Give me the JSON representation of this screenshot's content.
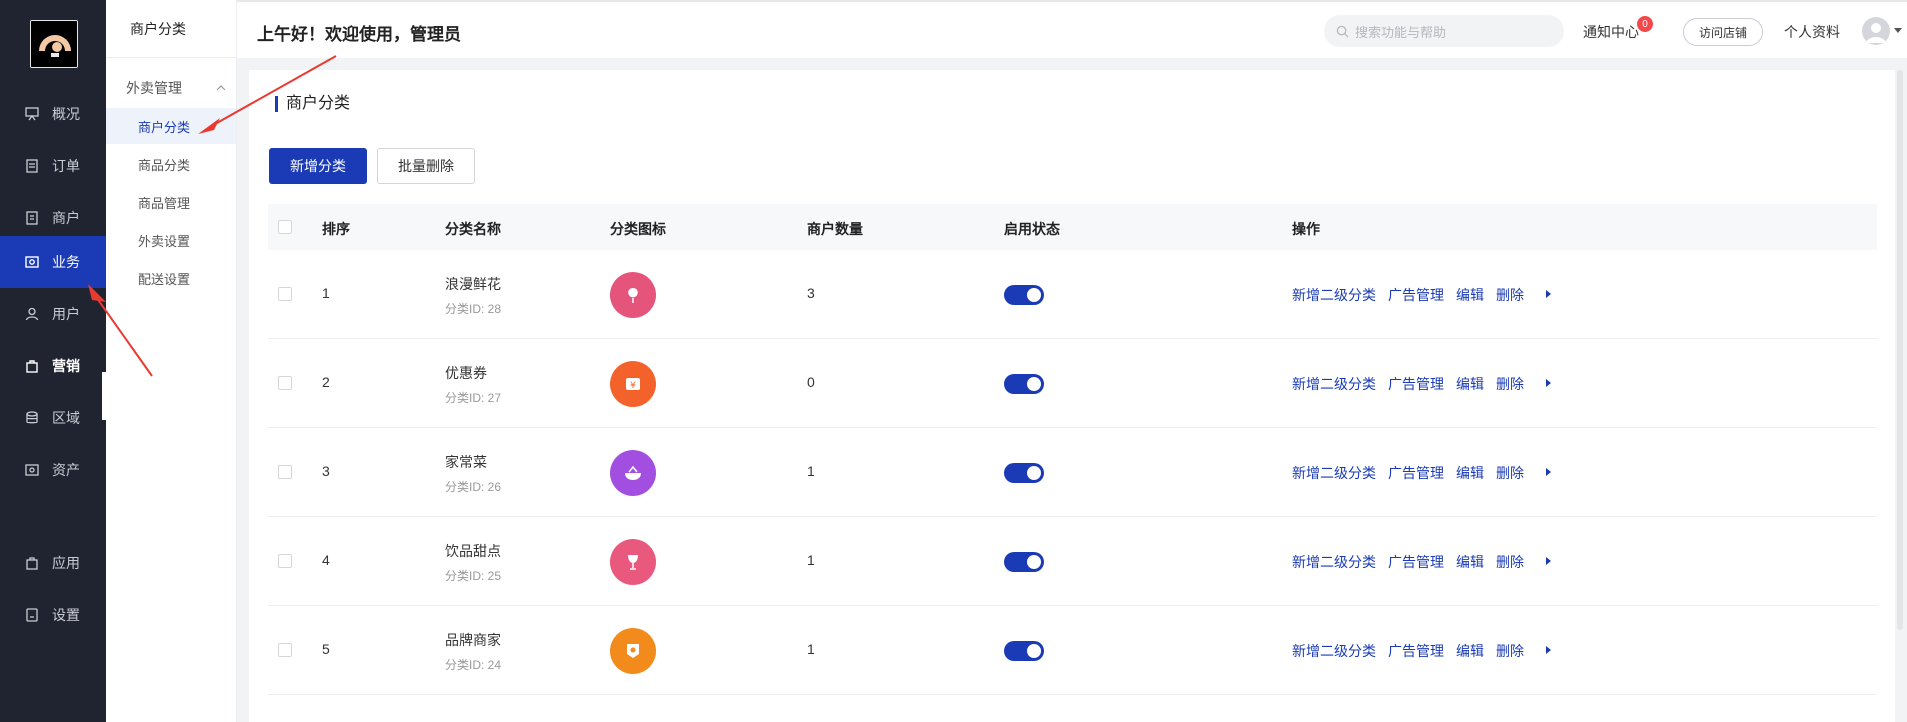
{
  "nav": {
    "items": [
      {
        "label": "概况",
        "icon": "presentation-board-icon"
      },
      {
        "label": "订单",
        "icon": "document-icon"
      },
      {
        "label": "商户",
        "icon": "store-icon"
      },
      {
        "label": "业务",
        "icon": "business-icon"
      },
      {
        "label": "用户",
        "icon": "user-icon"
      },
      {
        "label": "营销",
        "icon": "bag-icon"
      },
      {
        "label": "区域",
        "icon": "database-icon"
      },
      {
        "label": "资产",
        "icon": "wallet-icon"
      },
      {
        "label": "应用",
        "icon": "app-icon"
      },
      {
        "label": "设置",
        "icon": "settings-icon"
      }
    ],
    "active": "业务"
  },
  "subnav": {
    "title": "商户分类",
    "group": "外卖管理",
    "items": [
      {
        "label": "商户分类"
      },
      {
        "label": "商品分类"
      },
      {
        "label": "商品管理"
      },
      {
        "label": "外卖设置"
      },
      {
        "label": "配送设置"
      }
    ]
  },
  "header": {
    "greeting": "上午好！欢迎使用，管理员",
    "search_placeholder": "搜索功能与帮助",
    "notice_label": "通知中心",
    "notice_count": "0",
    "visit_label": "访问店铺",
    "profile_label": "个人资料"
  },
  "page": {
    "title": "商户分类",
    "add_button": "新增分类",
    "batch_delete_button": "批量删除"
  },
  "table": {
    "columns": [
      "排序",
      "分类名称",
      "分类图标",
      "商户数量",
      "启用状态",
      "操作"
    ],
    "rows": [
      {
        "sort": "1",
        "name": "浪漫鲜花",
        "id": "分类ID: 28",
        "count": "3",
        "icon": "rose-icon",
        "color": "#e5547a",
        "enabled": true
      },
      {
        "sort": "2",
        "name": "优惠券",
        "id": "分类ID: 27",
        "count": "0",
        "icon": "coupon-icon",
        "color": "#f4622b",
        "enabled": true
      },
      {
        "sort": "3",
        "name": "家常菜",
        "id": "分类ID: 26",
        "count": "1",
        "icon": "bowl-icon",
        "color": "#a24ee0",
        "enabled": true
      },
      {
        "sort": "4",
        "name": "饮品甜点",
        "id": "分类ID: 25",
        "count": "1",
        "icon": "wine-glass-icon",
        "color": "#e9587d",
        "enabled": true
      },
      {
        "sort": "5",
        "name": "品牌商家",
        "id": "分类ID: 24",
        "count": "1",
        "icon": "badge-icon",
        "color": "#f28a1c",
        "enabled": true
      }
    ],
    "actions": [
      "新增二级分类",
      "广告管理",
      "编辑",
      "删除"
    ]
  },
  "colors": {
    "primary": "#1a3bb5",
    "sidebar_bg": "#1f2430",
    "annotation_arrow": "#e83a30"
  }
}
